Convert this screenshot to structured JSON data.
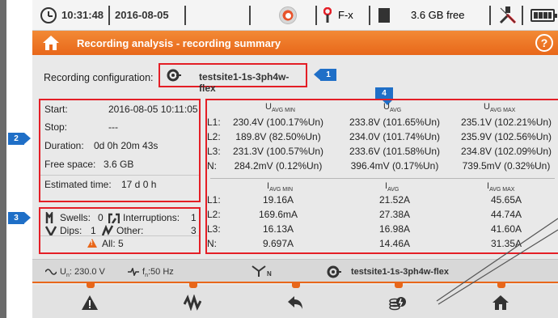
{
  "status_bar": {
    "time": "10:31:48",
    "date": "2016-08-05",
    "probe_label": "F-x",
    "free_space": "3.6 GB free",
    "icons": [
      "clock-icon",
      "record-icon",
      "clamp-icon",
      "sd-card-icon",
      "probe-icon",
      "battery-icon"
    ]
  },
  "title_bar": {
    "title": "Recording analysis - recording summary",
    "help_label": "?"
  },
  "config": {
    "label": "Recording configuration:",
    "value": "testsite1-1s-3ph4w-flex"
  },
  "callouts": [
    "1",
    "2",
    "3",
    "4"
  ],
  "info": {
    "start_label": "Start:",
    "start_value": "2016-08-05 10:11:05",
    "stop_label": "Stop:",
    "stop_value": "---",
    "duration_label": "Duration:",
    "duration_value": "0d 0h 20m 43s",
    "free_label": "Free space:",
    "free_value": "3.6 GB",
    "estimated_label": "Estimated time:",
    "estimated_value": "17 d 0 h"
  },
  "events": {
    "swells_label": "Swells:",
    "swells_value": "0",
    "interruptions_label": "Interruptions:",
    "interruptions_value": "1",
    "dips_label": "Dips:",
    "dips_value": "1",
    "other_label": "Other:",
    "other_value": "3",
    "all_label": "All: 5"
  },
  "voltage_table": {
    "headers": [
      "U",
      "U",
      "U"
    ],
    "header_subs": [
      "AVG MIN",
      "AVG",
      "AVG MAX"
    ],
    "rows": [
      {
        "label": "L1:",
        "min": "230.4V (100.17%Un)",
        "avg": "233.8V (101.65%Un)",
        "max": "235.1V (102.21%Un)"
      },
      {
        "label": "L2:",
        "min": "189.8V (82.50%Un)",
        "avg": "234.0V (101.74%Un)",
        "max": "235.9V (102.56%Un)"
      },
      {
        "label": "L3:",
        "min": "231.3V (100.57%Un)",
        "avg": "233.6V (101.58%Un)",
        "max": "234.8V (102.09%Un)"
      },
      {
        "label": "N:",
        "min": "284.2mV (0.12%Un)",
        "avg": "396.4mV (0.17%Un)",
        "max": "739.5mV (0.32%Un)"
      }
    ]
  },
  "current_table": {
    "headers": [
      "I",
      "I",
      "I"
    ],
    "header_subs": [
      "AVG MIN",
      "AVG",
      "AVG MAX"
    ],
    "rows": [
      {
        "label": "L1:",
        "min": "19.16A",
        "avg": "21.52A",
        "max": "45.65A"
      },
      {
        "label": "L2:",
        "min": "169.6mA",
        "avg": "27.38A",
        "max": "44.74A"
      },
      {
        "label": "L3:",
        "min": "16.13A",
        "avg": "16.98A",
        "max": "41.60A"
      },
      {
        "label": "N:",
        "min": "9.697A",
        "avg": "14.46A",
        "max": "31.35A"
      }
    ]
  },
  "info_strip": {
    "un_prefix": "U",
    "un_sub": "n",
    "un_value": ": 230.0 V",
    "fn_prefix": "f",
    "fn_sub": "n",
    "fn_value": ":50 Hz",
    "network_sub": "N",
    "config_name": "testsite1-1s-3ph4w-flex"
  },
  "toolbar": {
    "buttons": [
      "warning-events-icon",
      "waveform-icon",
      "back-arrow-icon",
      "energy-cost-icon",
      "home-icon"
    ]
  },
  "colors": {
    "accent_orange": "#e8671a",
    "highlight_red": "#e41e26",
    "callout_blue": "#1f6fc7"
  }
}
